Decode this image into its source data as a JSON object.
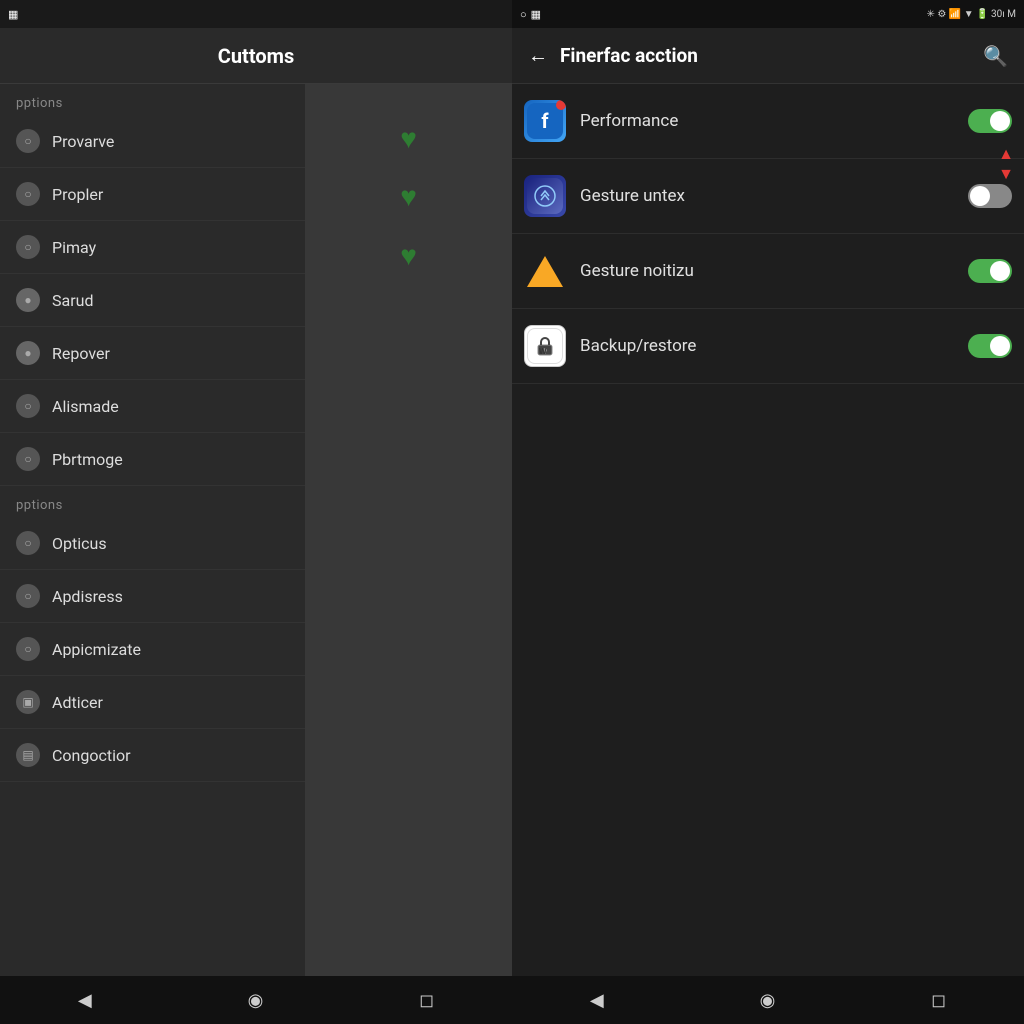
{
  "left_panel": {
    "status_bar": {
      "icon": "▦"
    },
    "title": "Cuttoms",
    "section1_label": "pptions",
    "nav_items_section1": [
      {
        "label": "Provarve",
        "icon": "○"
      },
      {
        "label": "Propler",
        "icon": "○"
      },
      {
        "label": "Pimay",
        "icon": "○"
      },
      {
        "label": "Sarud",
        "icon": "●"
      },
      {
        "label": "Repover",
        "icon": "●"
      },
      {
        "label": "Alismade",
        "icon": "○"
      },
      {
        "label": "Pbrtmoge",
        "icon": "○"
      }
    ],
    "section2_label": "pptions",
    "nav_items_section2": [
      {
        "label": "Opticus",
        "icon": "○"
      },
      {
        "label": "Apdisress",
        "icon": "○"
      },
      {
        "label": "Appicmizate",
        "icon": "○"
      },
      {
        "label": "Adticer",
        "icon": "○"
      },
      {
        "label": "Congoctior",
        "icon": "○"
      }
    ]
  },
  "right_panel": {
    "status_bar": {
      "left_icon": "○",
      "right_icons": "30ı M"
    },
    "title": "Finerfac acction",
    "back_button": "←",
    "search_button": "🔍",
    "settings_items": [
      {
        "id": "performance",
        "label": "Performance",
        "icon_type": "f_badge",
        "toggle_state": "on"
      },
      {
        "id": "gesture_untex",
        "label": "Gesture untex",
        "icon_type": "app_store",
        "toggle_state": "off"
      },
      {
        "id": "gesture_noitizu",
        "label": "Gesture noitizu",
        "icon_type": "triangle",
        "toggle_state": "on"
      },
      {
        "id": "backup_restore",
        "label": "Backup/restore",
        "icon_type": "lock",
        "toggle_state": "on"
      }
    ]
  },
  "nav_bar": {
    "back": "◀",
    "home": "◉",
    "recents": "◻"
  }
}
